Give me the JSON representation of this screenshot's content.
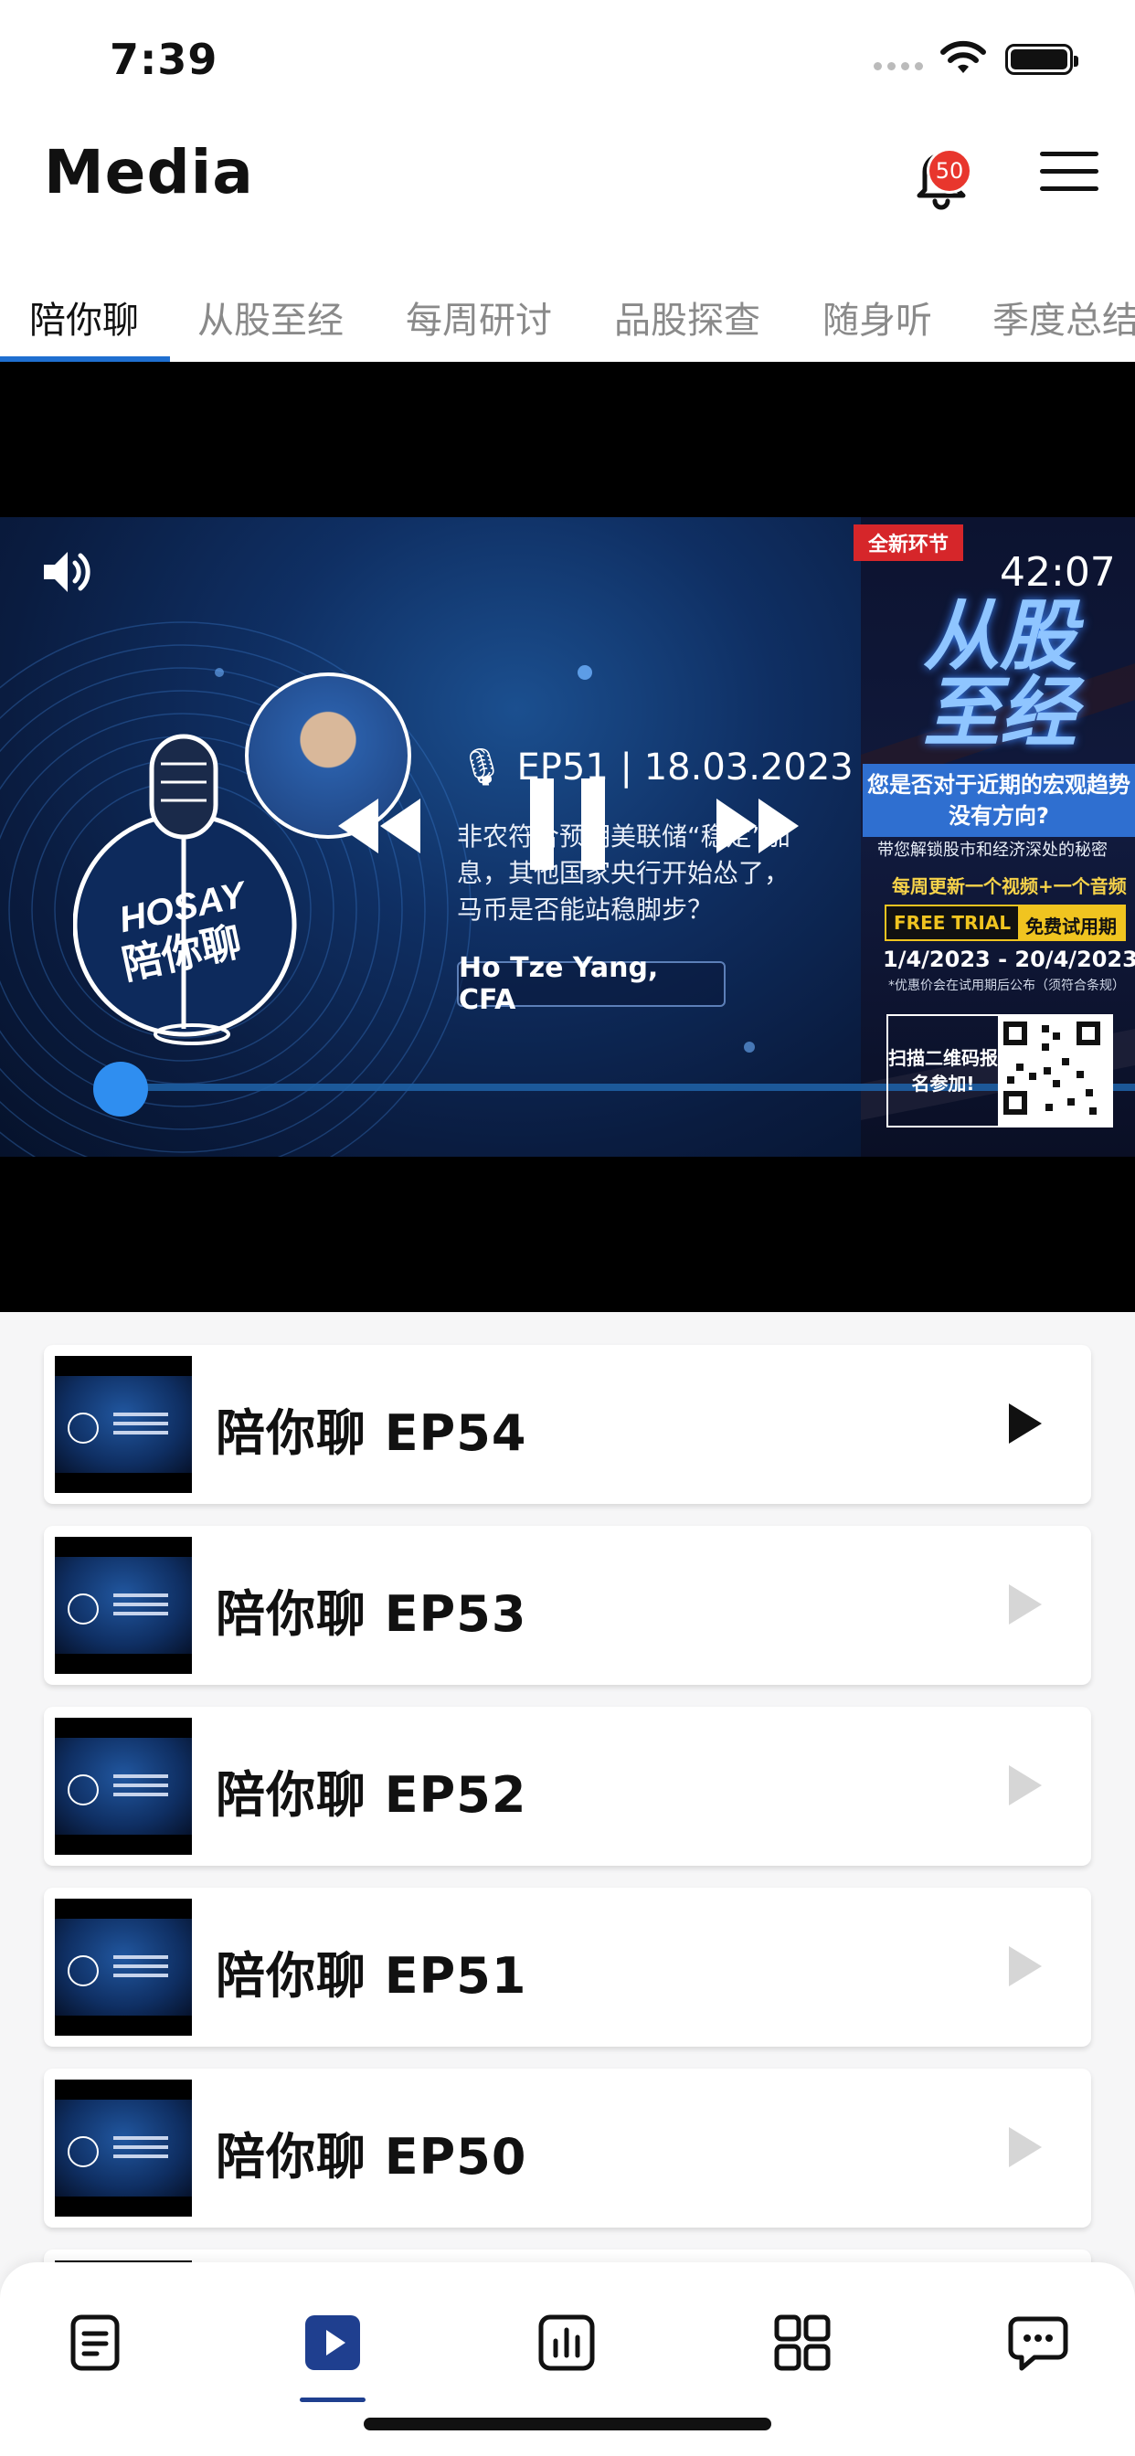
{
  "status_bar": {
    "time": "7:39"
  },
  "header": {
    "title": "Media",
    "notification_count": "50"
  },
  "tabs": [
    "陪你聊",
    "从股至经",
    "每周研讨",
    "品股探查",
    "随身听",
    "季度总结"
  ],
  "player": {
    "duration": "42:07",
    "episode_line": "EP51 | 18.03.2023",
    "description": "非农符合预期美联储“稳定”加息，其他国家央行开始怂了，马币是否能站稳脚步？",
    "host": "Ho Tze Yang, CFA",
    "logo_text_top": "HOSAY",
    "logo_text_bottom": "陪你聊",
    "progress": 0.0
  },
  "promo": {
    "tag": "全新环节",
    "title_line1": "从股",
    "title_line2": "至经",
    "question": "您是否对于近期的宏观趋势没有方向?",
    "subtitle": "带您解锁股市和经济深处的秘密",
    "weekly": "每周更新一个视频+一个音频",
    "trial_en": "FREE TRIAL",
    "trial_cn": "免费试用期",
    "dates": "1/4/2023 - 20/4/2023",
    "note": "*优惠价会在试用期后公布（须符合条规）",
    "scan": "扫描二维码报名参加!"
  },
  "episodes": [
    {
      "title": "陪你聊 EP54",
      "active": true
    },
    {
      "title": "陪你聊 EP53",
      "active": false
    },
    {
      "title": "陪你聊 EP52",
      "active": false
    },
    {
      "title": "陪你聊 EP51",
      "active": false
    },
    {
      "title": "陪你聊 EP50",
      "active": false
    }
  ],
  "bottom_nav": {
    "items": [
      "news-icon",
      "media-icon",
      "chart-icon",
      "apps-icon",
      "chat-icon"
    ],
    "active_index": 1
  },
  "colors": {
    "accent": "#1f6fd0",
    "badge": "#e8362d",
    "progress": "#2f8ef0"
  }
}
